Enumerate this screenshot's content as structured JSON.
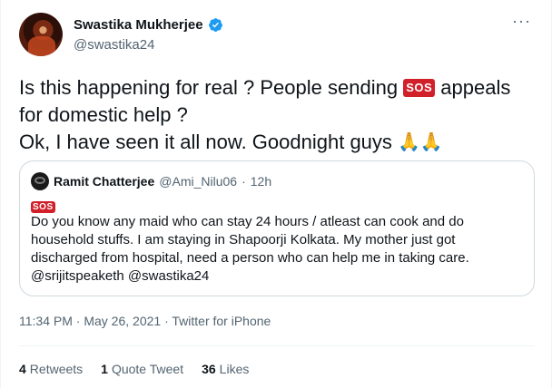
{
  "author": {
    "name": "Swastika Mukherjee",
    "handle": "@swastika24"
  },
  "tweet": {
    "line1_pre": "Is this happening for real ? People sending ",
    "sos_label": "SOS",
    "line1_post": " appeals",
    "line2": "for domestic help ?",
    "line3": "Ok, I have seen it all now. Goodnight guys ",
    "emoji": "🙏🙏"
  },
  "quoted": {
    "name": "Ramit Chatterjee",
    "handle": "@Ami_Nilu06",
    "separator": "·",
    "time": "12h",
    "sos_label": "SOS",
    "line1": "Do you know any maid who can stay 24 hours / atleast can cook and do",
    "line2": "household stuffs. I am staying in Shapoorji Kolkata. My mother just got",
    "line3": "discharged from hospital, need a person who can help me in taking care.",
    "line4": "@srijitspeaketh @swastika24"
  },
  "meta": {
    "time": "11:34 PM",
    "sep1": " · ",
    "date": "May 26, 2021",
    "sep2": " · ",
    "source": "Twitter for iPhone"
  },
  "stats": {
    "retweets_count": "4",
    "retweets_label": "Retweets",
    "quotes_count": "1",
    "quotes_label": "Quote Tweet",
    "likes_count": "36",
    "likes_label": "Likes"
  },
  "colors": {
    "text": "#0f1419",
    "secondary": "#536471",
    "sos_red": "#d1202a",
    "verified_blue": "#1d9bf0",
    "border": "#cfd9de"
  }
}
